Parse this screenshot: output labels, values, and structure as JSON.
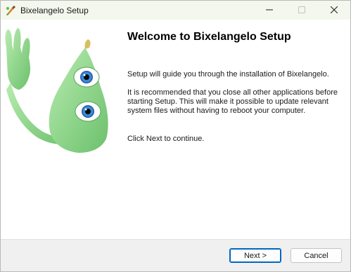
{
  "window": {
    "title": "Bixelangelo Setup",
    "controls": {
      "minimize_icon": "minimize-icon",
      "maximize_icon": "maximize-icon",
      "close_icon": "close-icon"
    }
  },
  "welcome": {
    "heading": "Welcome to Bixelangelo Setup",
    "paragraphs": [
      "Setup will guide you through the installation of Bixelangelo.",
      "It is recommended that you close all other applications before starting Setup. This will make it possible to update relevant system files without having to reboot your computer.",
      "Click Next to continue."
    ]
  },
  "buttons": {
    "next_label": "Next >",
    "cancel_label": "Cancel"
  },
  "colors": {
    "titlebar_bg": "#f3f7ed",
    "accent": "#0067c0",
    "mascot_green": "#8fd88f",
    "footer_bg": "#f0f0f0"
  }
}
